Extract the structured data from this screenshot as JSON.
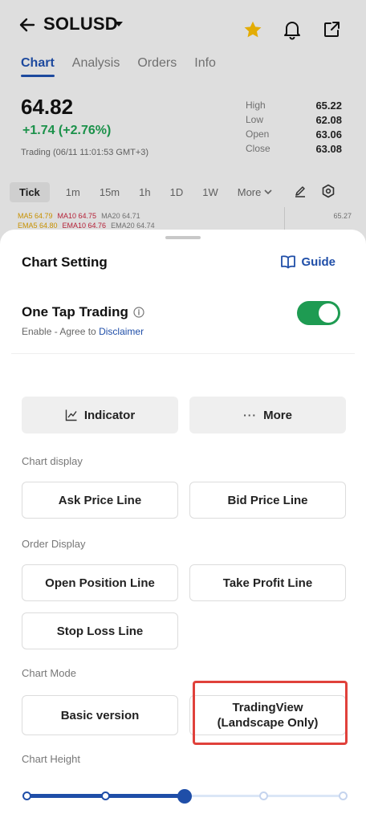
{
  "header": {
    "symbol": "SOLUSD",
    "icons": [
      "back-arrow-icon",
      "chevron-down-icon",
      "star-icon",
      "bell-icon",
      "share-icon"
    ],
    "star_color": "#f2b705"
  },
  "tabs": [
    {
      "label": "Chart",
      "active": true
    },
    {
      "label": "Analysis",
      "active": false
    },
    {
      "label": "Orders",
      "active": false
    },
    {
      "label": "Info",
      "active": false
    }
  ],
  "quote": {
    "price": "64.82",
    "change": "+1.74 (+2.76%)",
    "trading_time": "Trading (06/11 11:01:53 GMT+3)",
    "stats": [
      {
        "label": "High",
        "value": "65.22"
      },
      {
        "label": "Low",
        "value": "62.08"
      },
      {
        "label": "Open",
        "value": "63.06"
      },
      {
        "label": "Close",
        "value": "63.08"
      }
    ]
  },
  "intervals": {
    "items": [
      "Tick",
      "1m",
      "15m",
      "1h",
      "1D",
      "1W"
    ],
    "more_label": "More",
    "selected": "Tick"
  },
  "indicators": {
    "row1": [
      "MA5 64.79",
      "MA10 64.75",
      "MA20 64.71"
    ],
    "row2": [
      "EMA5 64.80",
      "EMA10 64.76",
      "EMA20 64.74"
    ],
    "right_value": "65.27"
  },
  "sheet": {
    "title": "Chart Setting",
    "guide_label": "Guide",
    "one_tap": {
      "title": "One Tap Trading",
      "subtitle": "Enable - Agree to ",
      "link": "Disclaimer",
      "enabled": true
    },
    "indicator_label": "Indicator",
    "more_label": "More",
    "more_dots": "···",
    "chart_display": {
      "title": "Chart display",
      "buttons": [
        "Ask Price Line",
        "Bid Price Line"
      ]
    },
    "order_display": {
      "title": "Order Display",
      "buttons": [
        "Open Position Line",
        "Take Profit Line",
        "Stop Loss Line"
      ]
    },
    "chart_mode": {
      "title": "Chart Mode",
      "basic": "Basic version",
      "tv_line1": "TradingView",
      "tv_line2": "(Landscape Only)"
    },
    "chart_height": {
      "title": "Chart Height",
      "steps": 5,
      "selected_step": 3
    }
  },
  "colors": {
    "accent": "#1f4ea8",
    "positive": "#1d9b4f",
    "toggle_on": "#1e9b52",
    "highlight": "#e0413b"
  }
}
